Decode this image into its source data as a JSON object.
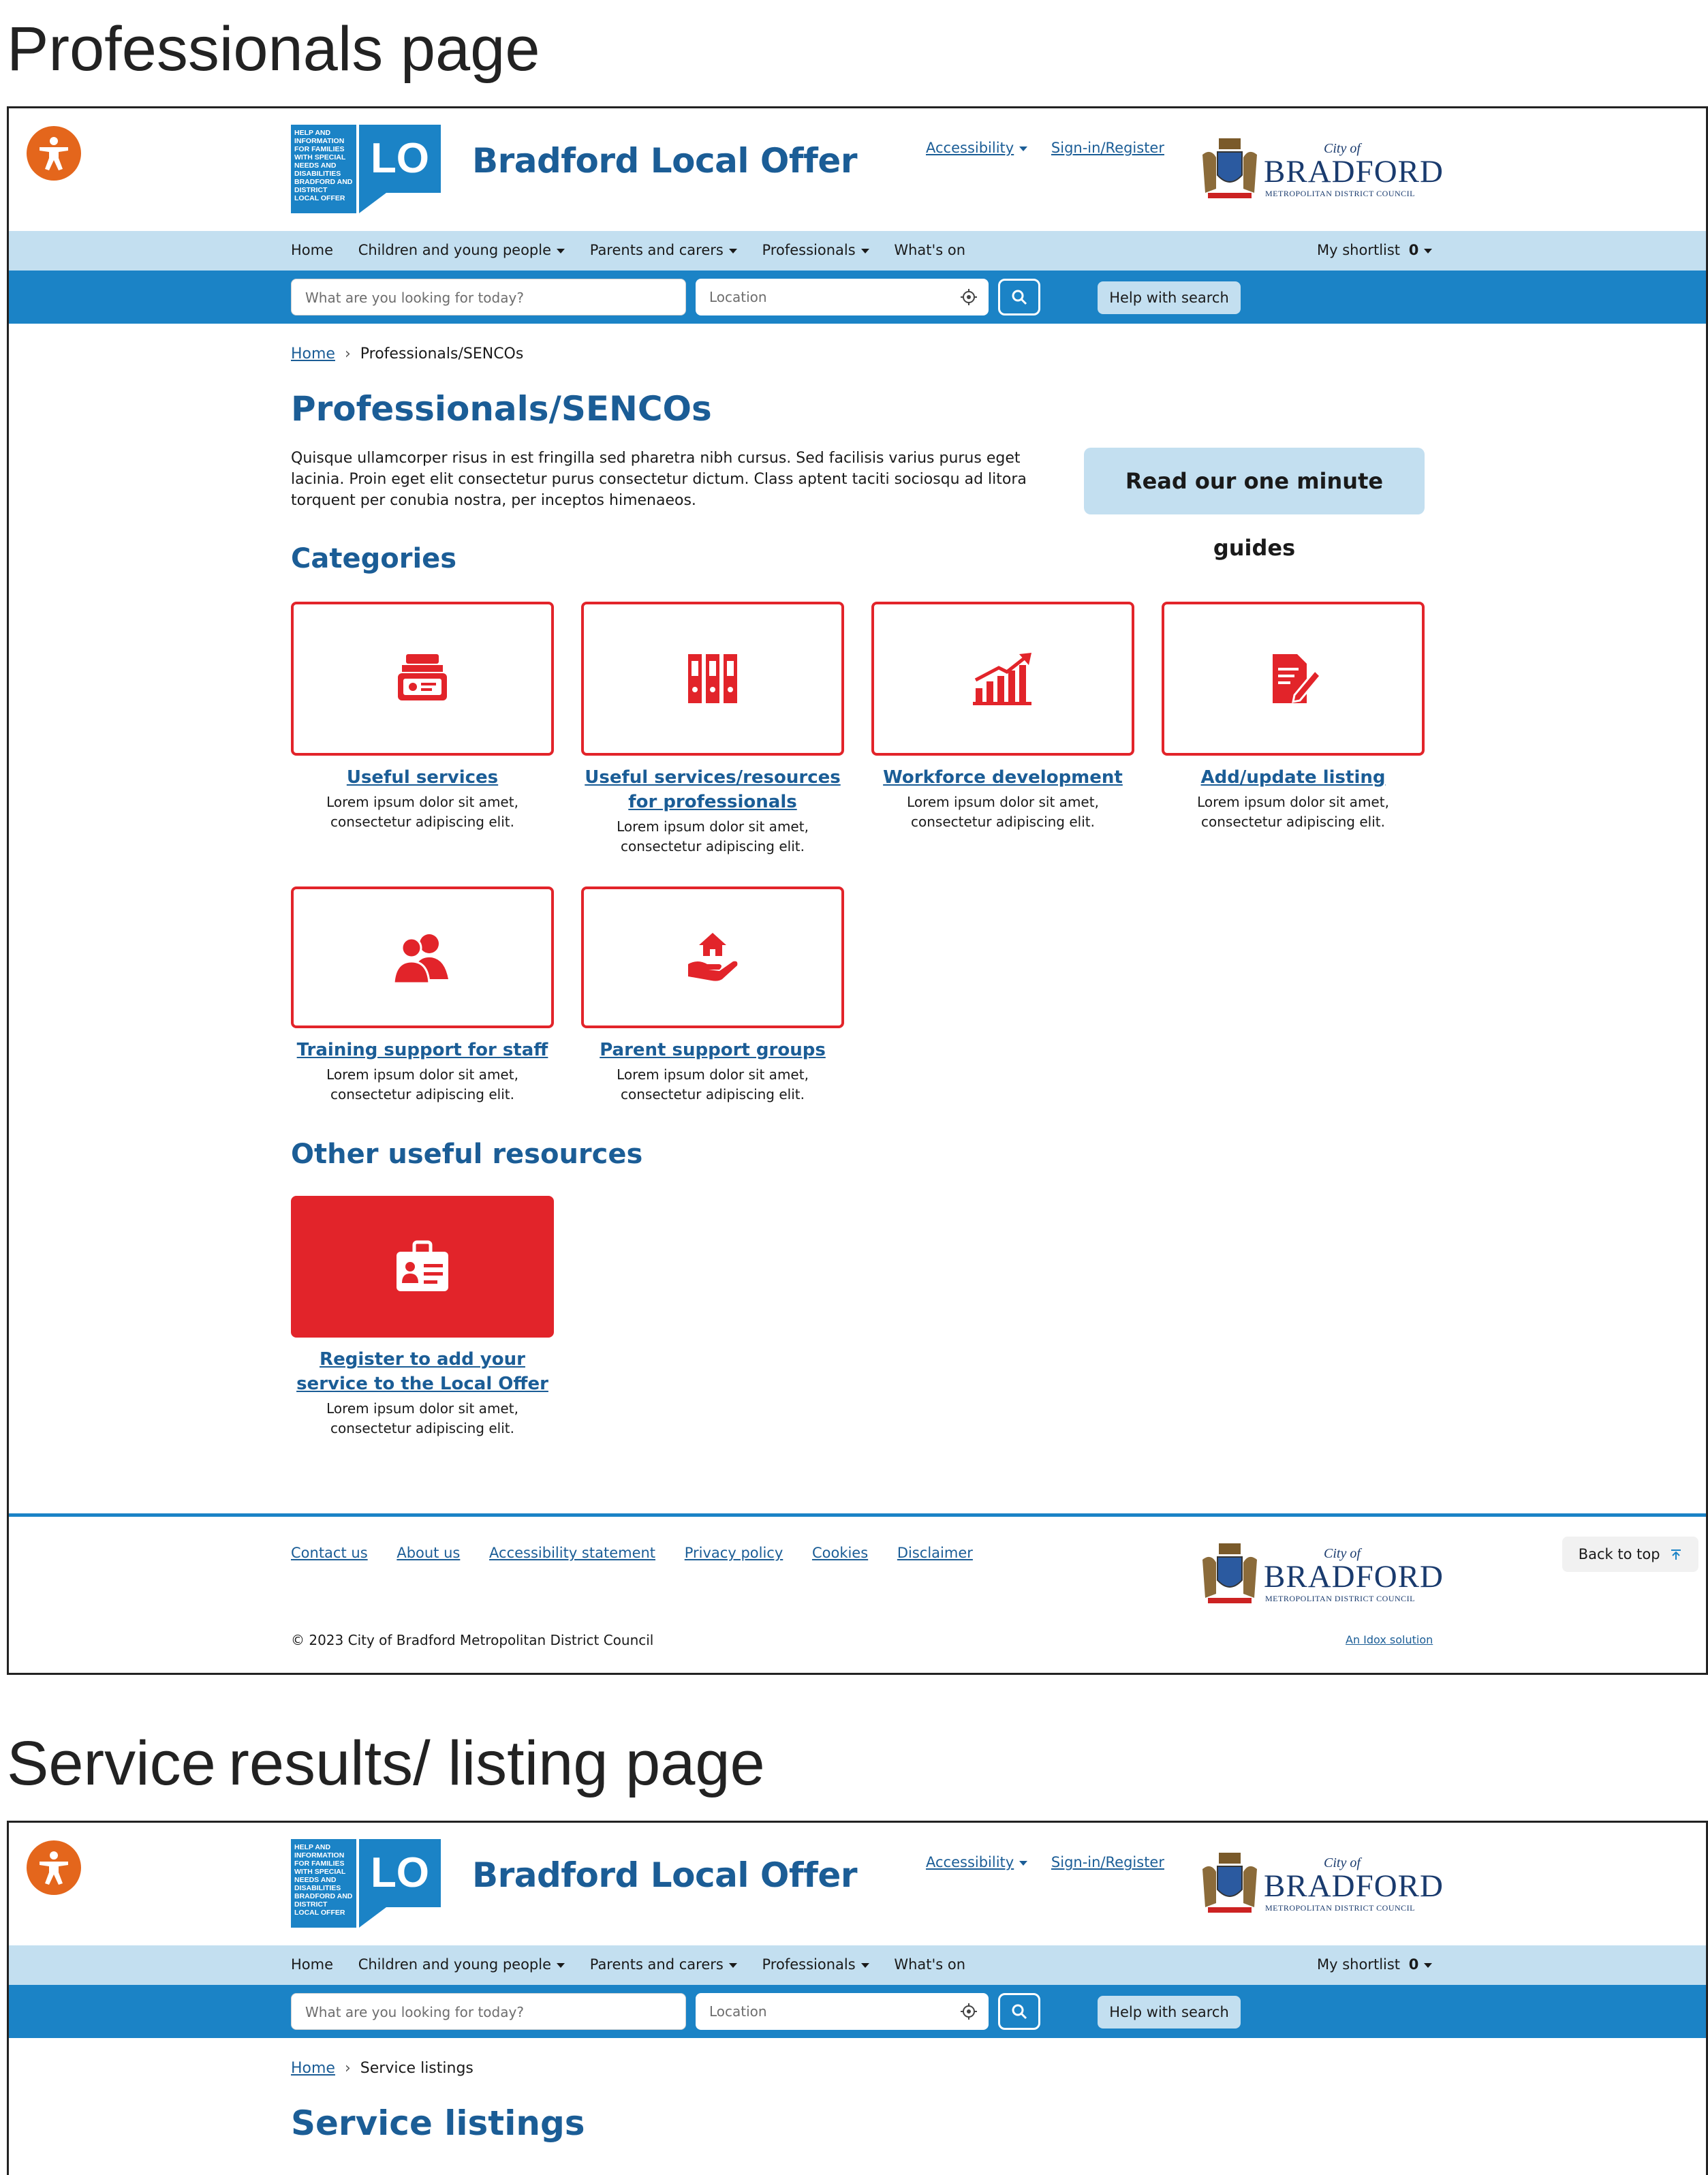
{
  "sections": [
    {
      "label": "Professionals page"
    },
    {
      "label": "Service results/ listing page"
    }
  ],
  "header": {
    "site_title": "Bradford Local Offer",
    "logo_small_text": "HELP AND\nINFORMATION\nFOR FAMILIES\nWITH SPECIAL\nNEEDS AND\nDISABILITIES\nBRADFORD AND DISTRICT\nLOCAL OFFER",
    "logo_letters": "LO",
    "accessibility_link": "Accessibility",
    "signin_link": "Sign-in/Register",
    "council": {
      "city_of": "City of",
      "name": "BRADFORD",
      "sub": "METROPOLITAN DISTRICT COUNCIL"
    }
  },
  "nav": {
    "items": [
      {
        "label": "Home",
        "dropdown": false
      },
      {
        "label": "Children and young people",
        "dropdown": true
      },
      {
        "label": "Parents and carers",
        "dropdown": true
      },
      {
        "label": "Professionals",
        "dropdown": true
      },
      {
        "label": "What's on",
        "dropdown": false
      }
    ],
    "shortlist_label": "My shortlist",
    "shortlist_count": "0"
  },
  "search": {
    "query_placeholder": "What are you looking for today?",
    "location_placeholder": "Location",
    "help_label": "Help with search"
  },
  "professionals_page": {
    "breadcrumb": {
      "home": "Home",
      "current": "Professionals/SENCOs"
    },
    "title": "Professionals/SENCOs",
    "intro": "Quisque ullamcorper risus in est fringilla sed pharetra nibh cursus. Sed facilisis varius purus eget lacinia. Proin eget elit consectetur purus consectetur dictum. Class aptent taciti sociosqu ad litora torquent per conubia nostra, per inceptos himenaeos.",
    "guides_button": "Read our one minute guides",
    "categories_heading": "Categories",
    "categories": [
      {
        "title": "Useful services",
        "desc": "Lorem ipsum dolor sit amet, consectetur adipiscing elit.",
        "icon": "services-icon"
      },
      {
        "title": "Useful services/resources for professionals",
        "desc": "Lorem ipsum dolor sit amet, consectetur adipiscing elit.",
        "icon": "binders-icon"
      },
      {
        "title": "Workforce development",
        "desc": "Lorem ipsum dolor sit amet, consectetur adipiscing elit.",
        "icon": "growth-chart-icon"
      },
      {
        "title": "Add/update listing",
        "desc": "Lorem ipsum dolor sit amet, consectetur adipiscing elit.",
        "icon": "edit-document-icon"
      },
      {
        "title": "Training support for staff",
        "desc": "Lorem ipsum dolor sit amet, consectetur adipiscing elit.",
        "icon": "people-icon"
      },
      {
        "title": "Parent support groups",
        "desc": "Lorem ipsum dolor sit amet, consectetur adipiscing elit.",
        "icon": "home-hand-icon"
      }
    ],
    "other_heading": "Other useful resources",
    "other": [
      {
        "title": "Register to add your service to the Local Offer",
        "desc": "Lorem ipsum dolor sit amet, consectetur adipiscing elit.",
        "icon": "id-badge-icon"
      }
    ]
  },
  "footer": {
    "links": [
      "Contact us",
      "About us",
      "Accessibility statement",
      "Privacy policy",
      "Cookies",
      "Disclaimer"
    ],
    "copyright": "© 2023 City of Bradford Metropolitan District Council",
    "idox": "An Idox solution",
    "back_to_top": "Back to top"
  },
  "listing_page": {
    "breadcrumb": {
      "home": "Home",
      "current": "Service listings"
    },
    "title": "Service listings"
  },
  "colors": {
    "brand_blue": "#1b83c6",
    "title_blue": "#1b5d96",
    "nav_light": "#c3dff0",
    "accent_red": "#e2242a",
    "access_orange": "#e4661c"
  }
}
